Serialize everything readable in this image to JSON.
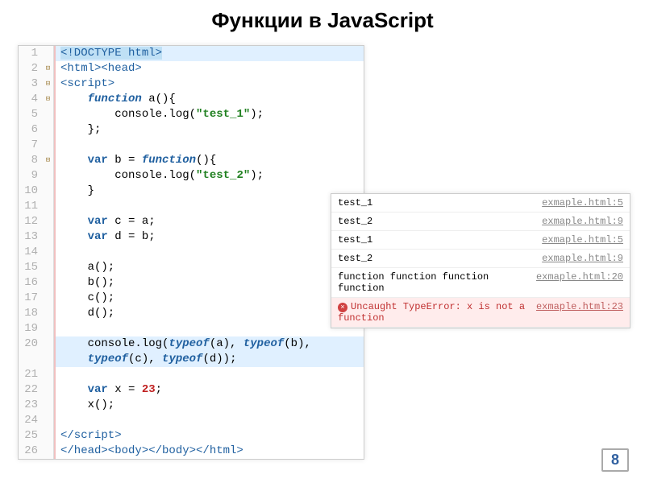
{
  "title": "Функции в JavaScript",
  "page_number": "8",
  "code_lines": [
    {
      "n": 1,
      "fold": " ",
      "hl": true,
      "html": "<span class='kw-doctype'>&lt;!DOCTYPE html&gt;</span>"
    },
    {
      "n": 2,
      "fold": "⊟",
      "hl": false,
      "html": "<span class='kw-tag'>&lt;html&gt;&lt;head&gt;</span>"
    },
    {
      "n": 3,
      "fold": "⊟",
      "hl": false,
      "html": "<span class='kw-tag'>&lt;script&gt;</span>"
    },
    {
      "n": 4,
      "fold": "⊟",
      "hl": false,
      "html": "    <span class='kw-func'>function</span> a(){"
    },
    {
      "n": 5,
      "fold": " ",
      "hl": false,
      "html": "        console.log(<span class='str'>\"test_1\"</span>);"
    },
    {
      "n": 6,
      "fold": " ",
      "hl": false,
      "html": "    };"
    },
    {
      "n": 7,
      "fold": " ",
      "hl": false,
      "html": ""
    },
    {
      "n": 8,
      "fold": "⊟",
      "hl": false,
      "html": "    <span class='kw-var'>var</span> b = <span class='kw-func'>function</span>(){"
    },
    {
      "n": 9,
      "fold": " ",
      "hl": false,
      "html": "        console.log(<span class='str'>\"test_2\"</span>);"
    },
    {
      "n": 10,
      "fold": " ",
      "hl": false,
      "html": "    }"
    },
    {
      "n": 11,
      "fold": " ",
      "hl": false,
      "html": ""
    },
    {
      "n": 12,
      "fold": " ",
      "hl": false,
      "html": "    <span class='kw-var'>var</span> c = a;"
    },
    {
      "n": 13,
      "fold": " ",
      "hl": false,
      "html": "    <span class='kw-var'>var</span> d = b;"
    },
    {
      "n": 14,
      "fold": " ",
      "hl": false,
      "html": ""
    },
    {
      "n": 15,
      "fold": " ",
      "hl": false,
      "html": "    a();"
    },
    {
      "n": 16,
      "fold": " ",
      "hl": false,
      "html": "    b();"
    },
    {
      "n": 17,
      "fold": " ",
      "hl": false,
      "html": "    c();"
    },
    {
      "n": 18,
      "fold": " ",
      "hl": false,
      "html": "    d();"
    },
    {
      "n": 19,
      "fold": " ",
      "hl": false,
      "html": ""
    },
    {
      "n": 20,
      "fold": " ",
      "hl": true,
      "html": "    console.log(<span class='kw-func'>typeof</span>(a), <span class='kw-func'>typeof</span>(b),"
    },
    {
      "n": "",
      "fold": " ",
      "hl": true,
      "html": "    <span class='kw-func'>typeof</span>(c), <span class='kw-func'>typeof</span>(d));"
    },
    {
      "n": 21,
      "fold": " ",
      "hl": false,
      "html": ""
    },
    {
      "n": 22,
      "fold": " ",
      "hl": false,
      "html": "    <span class='kw-var'>var</span> x = <span class='num'>23</span>;"
    },
    {
      "n": 23,
      "fold": " ",
      "hl": false,
      "html": "    x();"
    },
    {
      "n": 24,
      "fold": " ",
      "hl": false,
      "html": ""
    },
    {
      "n": 25,
      "fold": " ",
      "hl": false,
      "html": "<span class='kw-tag'>&lt;/script&gt;</span>"
    },
    {
      "n": 26,
      "fold": " ",
      "hl": false,
      "html": "<span class='kw-tag'>&lt;/head&gt;&lt;body&gt;&lt;/body&gt;&lt;/html&gt;</span>"
    }
  ],
  "console_rows": [
    {
      "msg": "test_1",
      "src": "exmaple.html:5",
      "err": false
    },
    {
      "msg": "test_2",
      "src": "exmaple.html:9",
      "err": false
    },
    {
      "msg": "test_1",
      "src": "exmaple.html:5",
      "err": false
    },
    {
      "msg": "test_2",
      "src": "exmaple.html:9",
      "err": false
    },
    {
      "msg": "function function function function",
      "src": "exmaple.html:20",
      "err": false
    },
    {
      "msg": "Uncaught TypeError: x is not a function",
      "src": "exmaple.html:23",
      "err": true
    }
  ]
}
